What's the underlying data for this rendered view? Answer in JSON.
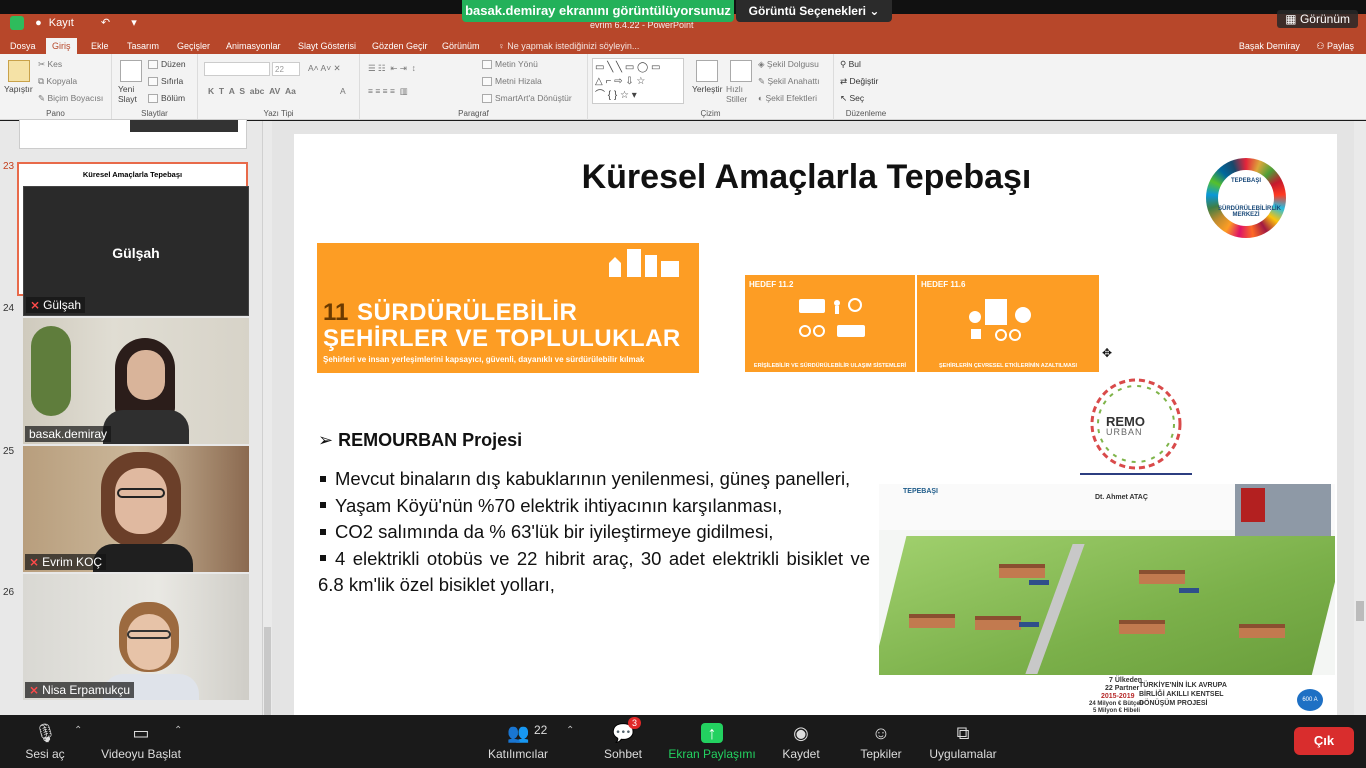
{
  "zoom": {
    "share_banner": "basak.demiray ekranını görüntülüyorsunuz",
    "view_options": "Görüntü Seçenekleri",
    "view_button": "Görünüm",
    "toolbar": {
      "mute": "Sesi aç",
      "video": "Videoyu Başlat",
      "participants": "Katılımcılar",
      "participants_count": "22",
      "chat": "Sohbet",
      "chat_badge": "3",
      "share": "Ekran Paylaşımı",
      "record": "Kaydet",
      "reactions": "Tepkiler",
      "apps": "Uygulamalar",
      "exit": "Çık"
    }
  },
  "powerpoint": {
    "title": "evrim 6.4.22 - PowerPoint",
    "quick_access": "Kayıt",
    "tabs": [
      "Dosya",
      "Giriş",
      "Ekle",
      "Tasarım",
      "Geçişler",
      "Animasyonlar",
      "Slayt Gösterisi",
      "Gözden Geçir",
      "Görünüm",
      "Ne yapmak istediğinizi söyleyin..."
    ],
    "user": "Başak Demiray",
    "share": "Paylaş",
    "ribbon": {
      "pano": {
        "label": "Pano",
        "paste": "Yapıştır",
        "cut": "Kes",
        "copy": "Kopyala",
        "format": "Biçim Boyacısı"
      },
      "slaytlar": {
        "label": "Slaytlar",
        "new": "Yeni Slayt",
        "layout": "Düzen",
        "reset": "Sıfırla",
        "section": "Bölüm"
      },
      "yazitipi": {
        "label": "Yazı Tipi",
        "size": "22"
      },
      "paragraf": {
        "label": "Paragraf",
        "dir": "Metin Yönü",
        "align": "Metni Hizala",
        "smart": "SmartArt'a Dönüştür"
      },
      "cizim": {
        "label": "Çizim",
        "arrange": "Yerleştir",
        "quick": "Hızlı Stiller",
        "fill": "Şekil Dolgusu",
        "outline": "Şekil Anahattı",
        "effects": "Şekil Efektleri"
      },
      "duzenleme": {
        "label": "Düzenleme",
        "find": "Bul",
        "replace": "Değiştir",
        "select": "Seç"
      }
    },
    "thumbs": [
      {
        "num": "23",
        "title": "Küresel Amaçlarla Tepebaşı"
      },
      {
        "num": "24"
      },
      {
        "num": "25"
      },
      {
        "num": "26"
      }
    ]
  },
  "participants": [
    {
      "name": "Gülşah",
      "muted": true,
      "video": false
    },
    {
      "name": "basak.demiray",
      "muted": false,
      "video": true
    },
    {
      "name": "Evrim KOÇ",
      "muted": true,
      "video": true
    },
    {
      "name": "Nisa Erpamukçu",
      "muted": true,
      "video": true
    }
  ],
  "slide": {
    "title": "Küresel Amaçlarla Tepebaşı",
    "logo_top": "TEPEBAŞI",
    "logo_bottom": "SÜRDÜRÜLEBİLİRLİK MERKEZİ",
    "sdg": {
      "number": "11",
      "line1": "SÜRDÜRÜLEBİLİR",
      "line2": "ŞEHİRLER VE TOPLULUKLAR",
      "desc": "Şehirleri ve insan yerleşimlerini kapsayıcı, güvenli, dayanıklı ve sürdürülebilir kılmak"
    },
    "targets": [
      {
        "label": "HEDEF 11.2",
        "caption": "ERİŞİLEBİLİR VE SÜRDÜRÜLEBİLİR ULAŞIM SİSTEMLERİ"
      },
      {
        "label": "HEDEF 11.6",
        "caption": "ŞEHİRLERİN ÇEVRESEL ETKİLERİNİN AZALTILMASI"
      }
    ],
    "remo": {
      "title": "REMO",
      "sub": "URBAN"
    },
    "project_heading": "REMOURBAN Projesi",
    "bullets": [
      "Mevcut binaların dış kabuklarının yenilenmesi, güneş panelleri,",
      "Yaşam Köyü'nün %70 elektrik ihtiyacının karşılanması,",
      "CO2 salımında da % 63'lük bir iyileştirmeye gidilmesi,",
      "4 elektrikli otobüs ve 22 hibrit araç, 30 adet elektrikli bisiklet ve 6.8 km'lik özel bisiklet yolları,"
    ],
    "poster": {
      "org": "TEPEBAŞI",
      "person": "Dt. Ahmet ATAÇ",
      "countries": "7 Ülkeden",
      "partners": "22 Partner",
      "years": "2015-2019",
      "budget1": "24 Milyon € Bütçeli",
      "budget2": "5 Milyon € Hibeli",
      "headline": "TÜRKİYE'NİN İLK AVRUPA BİRLİĞİ AKILLI KENTSEL DÖNÜŞÜM PROJESİ",
      "stat": "600 A"
    }
  }
}
